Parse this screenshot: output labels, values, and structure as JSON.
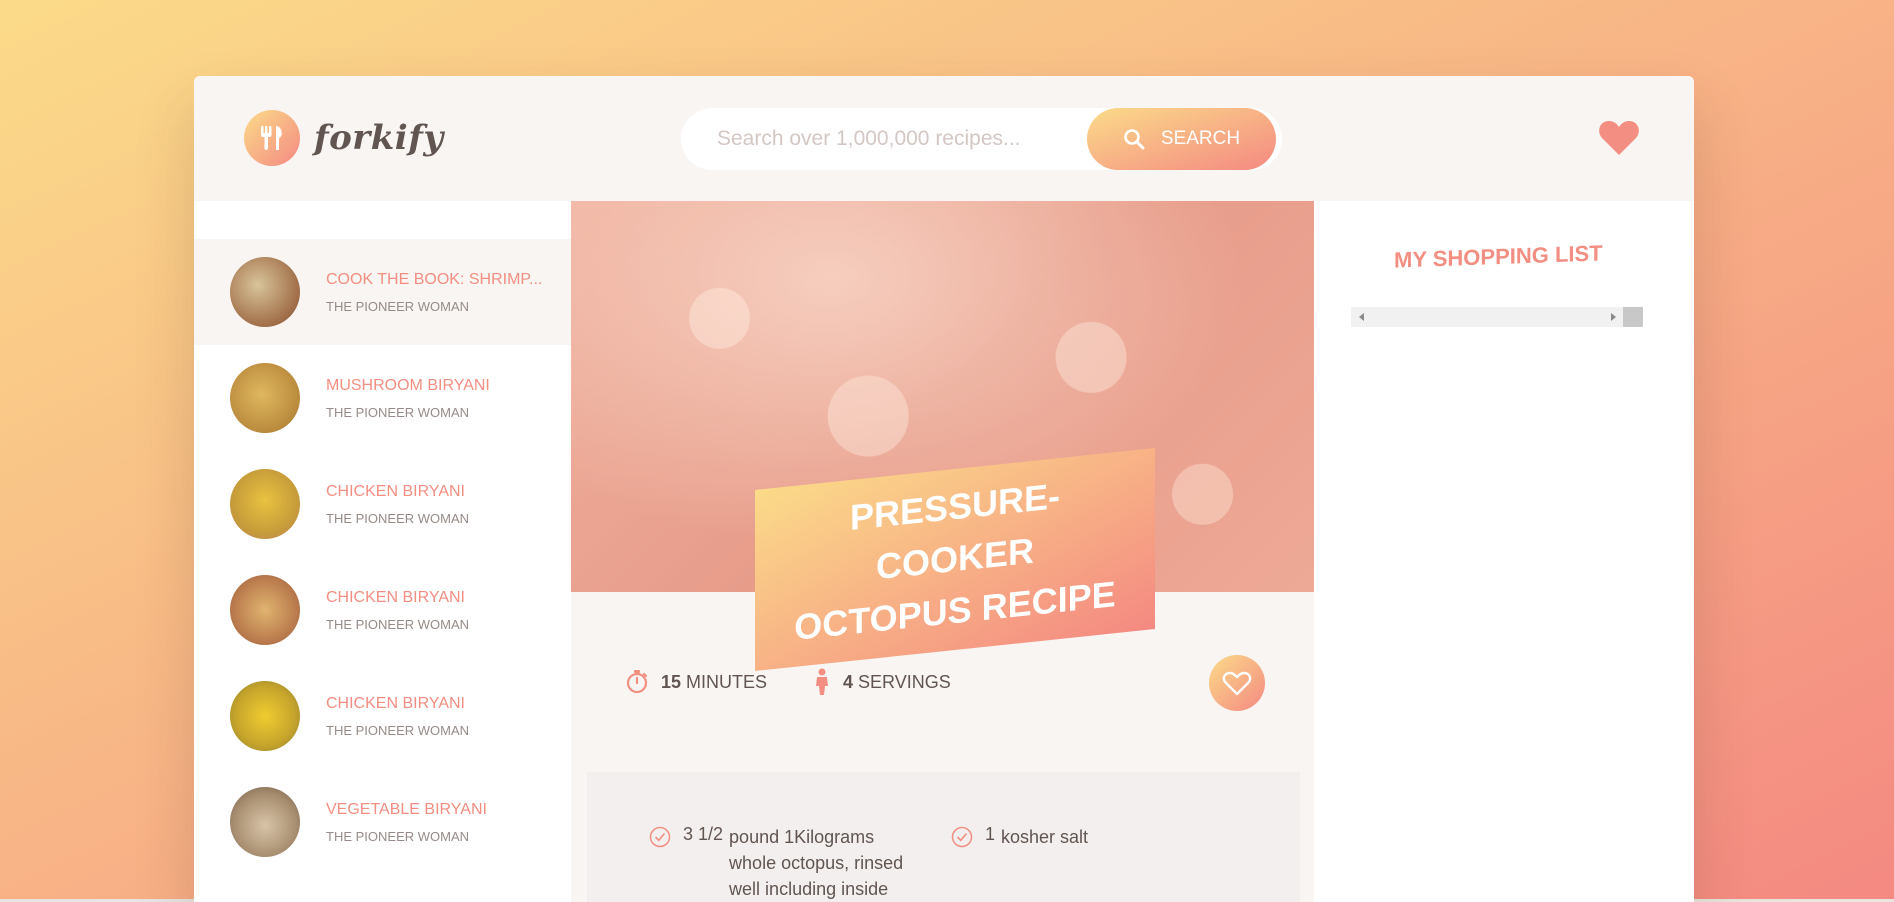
{
  "app": {
    "name": "forkify"
  },
  "search": {
    "placeholder": "Search over 1,000,000 recipes...",
    "button_label": "Search"
  },
  "results": [
    {
      "title": "Cook the Book: Shrimp...",
      "author": "The Pioneer Woman",
      "active": true,
      "thumb_color": "#b98a5c"
    },
    {
      "title": "Mushroom Biryani",
      "author": "The Pioneer Woman",
      "active": false,
      "thumb_color": "#c99a48"
    },
    {
      "title": "Chicken Biryani",
      "author": "The Pioneer Woman",
      "active": false,
      "thumb_color": "#d4a840"
    },
    {
      "title": "Chicken Biryani",
      "author": "The Pioneer Woman",
      "active": false,
      "thumb_color": "#b97a4c"
    },
    {
      "title": "Chicken Biryani",
      "author": "The Pioneer Woman",
      "active": false,
      "thumb_color": "#c5a42c"
    },
    {
      "title": "Vegetable Biryani",
      "author": "The Pioneer Woman",
      "active": false,
      "thumb_color": "#a88e70"
    }
  ],
  "recipe": {
    "title_line1": "Pressure-Cooker",
    "title_line2": "Octopus Recipe",
    "time_value": "15",
    "time_unit": "minutes",
    "servings_value": "4",
    "servings_unit": "servings",
    "ingredients": [
      {
        "count": "3 1/2",
        "text": "pound 1Kilograms whole octopus, rinsed well including inside"
      },
      {
        "count": "1",
        "text": "kosher salt"
      }
    ]
  },
  "shopping": {
    "title": "My Shopping List"
  },
  "colors": {
    "accent_start": "#fbdb89",
    "accent_end": "#f48982",
    "text": "#615551"
  }
}
